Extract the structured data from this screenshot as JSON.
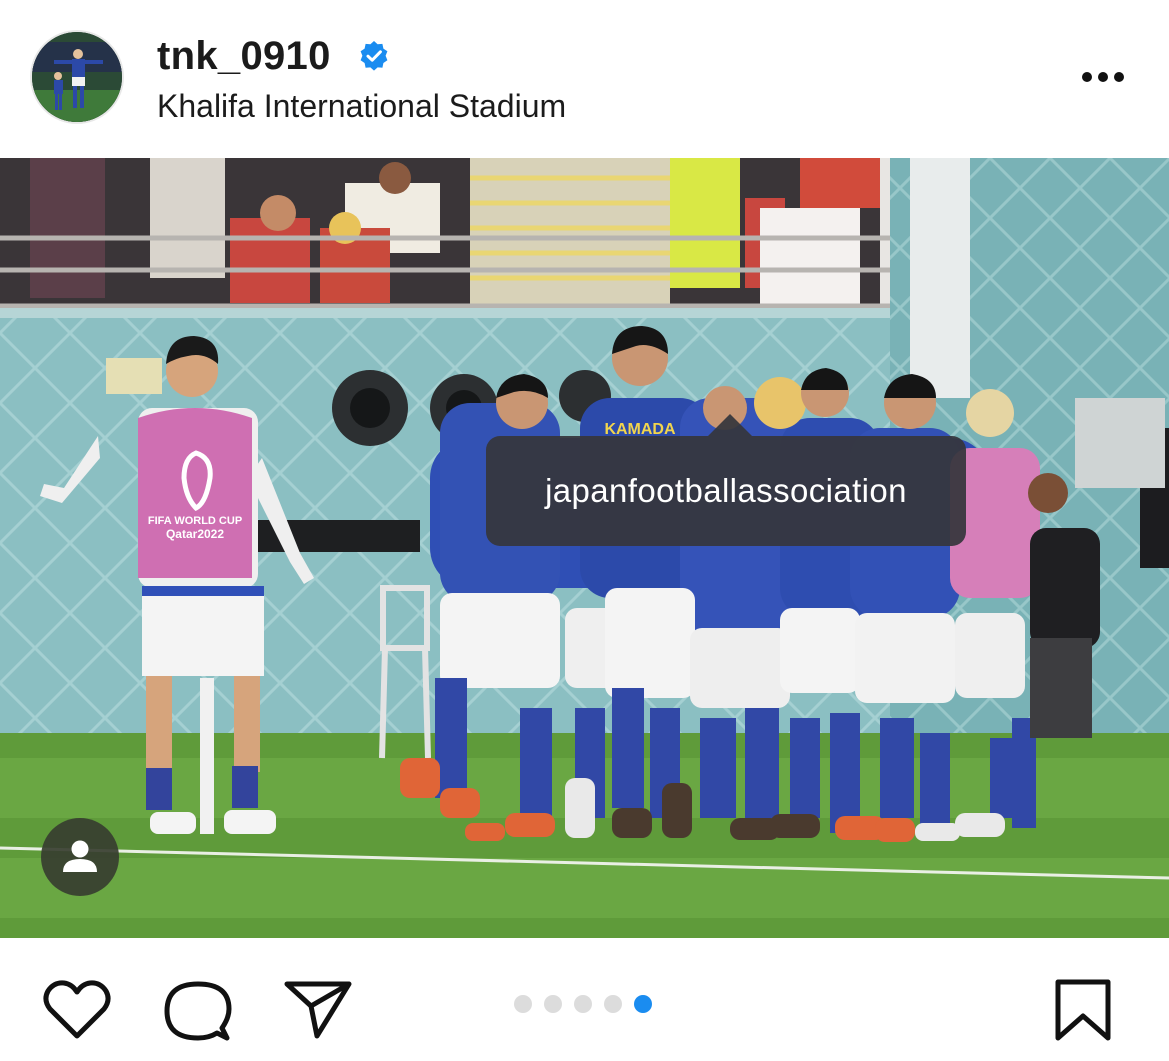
{
  "post": {
    "username": "tnk_0910",
    "location": "Khalifa International Stadium",
    "verified": true
  },
  "photo": {
    "tag_label": "japanfootballassociation",
    "jersey_text": "KAMADA",
    "bib_text": "FIFA WORLD CUP Qatar2022"
  },
  "carousel": {
    "total": 5,
    "active_index": 5
  },
  "icons": {
    "more": "more-horizontal-icon",
    "like": "heart-icon",
    "comment": "comment-bubble-icon",
    "share": "send-paper-plane-icon",
    "save": "bookmark-icon",
    "user_tags": "person-icon",
    "verified": "verified-badge-icon"
  },
  "colors": {
    "verified_blue": "#1a8cf0",
    "dot_active": "#1a8cf0",
    "dot_inactive": "#dcdcdc",
    "tooltip_bg": "#36363c"
  }
}
